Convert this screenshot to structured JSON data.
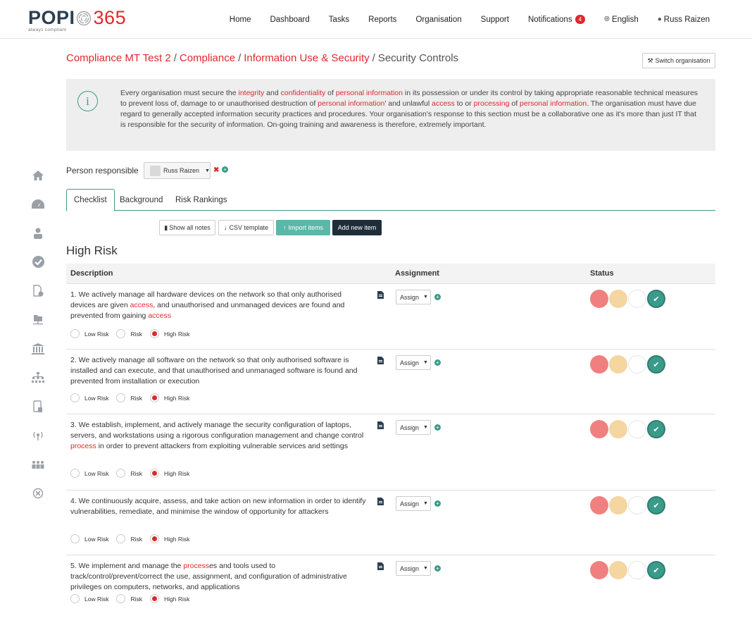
{
  "brand": {
    "name": "POPI",
    "number": "365",
    "tagline": "always compliant",
    "accent": "#e0282d",
    "teal": "#3b9b8a"
  },
  "nav": {
    "items": [
      "Home",
      "Dashboard",
      "Tasks",
      "Reports",
      "Organisation",
      "Support"
    ],
    "notifications_label": "Notifications",
    "notifications_count": "4",
    "language": "English",
    "user": "Russ Raizen"
  },
  "sidebar": {
    "icons": [
      "home-icon",
      "dashboard-icon",
      "user-icon",
      "check-icon",
      "document-settings-icon",
      "folder-network-icon",
      "bank-icon",
      "org-chart-icon",
      "mobile-document-icon",
      "broadcast-icon",
      "team-icon",
      "globe-x-icon"
    ]
  },
  "breadcrumb": {
    "items": [
      "Compliance MT Test 2",
      "Compliance",
      "Information Use & Security"
    ],
    "current": "Security Controls"
  },
  "switch_org_label": "Switch organisation",
  "info": {
    "p1": "Every organisation must secure the ",
    "k1": "integrity",
    "p2": " and ",
    "k2": "confidentiality",
    "p3": " of ",
    "k3": "personal information",
    "p4": " in its possession or under its control by taking appropriate reasonable technical measures to prevent loss of, damage to or unauthorised destruction of ",
    "k4": "personal information",
    "p5": "' and unlawful ",
    "k5": "access",
    "p6": " to or ",
    "k6": "processing",
    "p7": " of ",
    "k7": "personal information",
    "p8": ". The organisation must have due regard to generally accepted information security practices and procedures. Your organisation's response to this section must be a collaborative one as it's more than just IT that is responsible for the security of information. On-going training and awareness is therefore, extremely important."
  },
  "person": {
    "label": "Person responsible",
    "value": "Russ Raizen"
  },
  "tabs": [
    "Checklist",
    "Background",
    "Risk Rankings"
  ],
  "toolbar": {
    "show_notes": "Show all notes",
    "csv": "CSV template",
    "import": "Import items",
    "add": "Add new item"
  },
  "section_title": "High Risk",
  "table": {
    "col_desc": "Description",
    "col_assign": "Assignment",
    "col_status": "Status"
  },
  "risk_labels": [
    "Low Risk",
    "Risk",
    "High Risk"
  ],
  "assign_label": "Assign",
  "rows": [
    {
      "a": "1. We actively manage all hardware devices on the network so that only authorised devices are given ",
      "b": "access",
      "c": ", and unauthorised and unmanaged devices are found and prevented from gaining ",
      "d": "access",
      "e": "",
      "risk": "High Risk",
      "status": "green"
    },
    {
      "a": "2. We actively manage all software on the network so that only authorised software is installed and can execute, and that unauthorised and unmanaged software is found and prevented from installation or execution",
      "b": "",
      "c": "",
      "d": "",
      "e": "",
      "risk": "High Risk",
      "status": "green"
    },
    {
      "a": "3. We establish, implement, and actively manage the security configuration of laptops, servers, and workstations using a rigorous configuration management and change control ",
      "b": "process",
      "c": " in order to prevent attackers from exploiting vulnerable services and settings",
      "d": "",
      "e": "",
      "risk": "High Risk",
      "status": "green"
    },
    {
      "a": "4. We continuously acquire, assess, and take action on new information in order to identify vulnerabilities, remediate, and minimise the window of opportunity for attackers",
      "b": "",
      "c": "",
      "d": "",
      "e": "",
      "risk": "High Risk",
      "status": "green"
    },
    {
      "a": "5. We implement and manage the ",
      "b": "process",
      "c": "es and tools used to track/control/prevent/correct the use, assignment, and configuration of administrative privileges on computers, networks, and applications",
      "d": "",
      "e": "",
      "risk": "High Risk",
      "status": "green"
    }
  ]
}
